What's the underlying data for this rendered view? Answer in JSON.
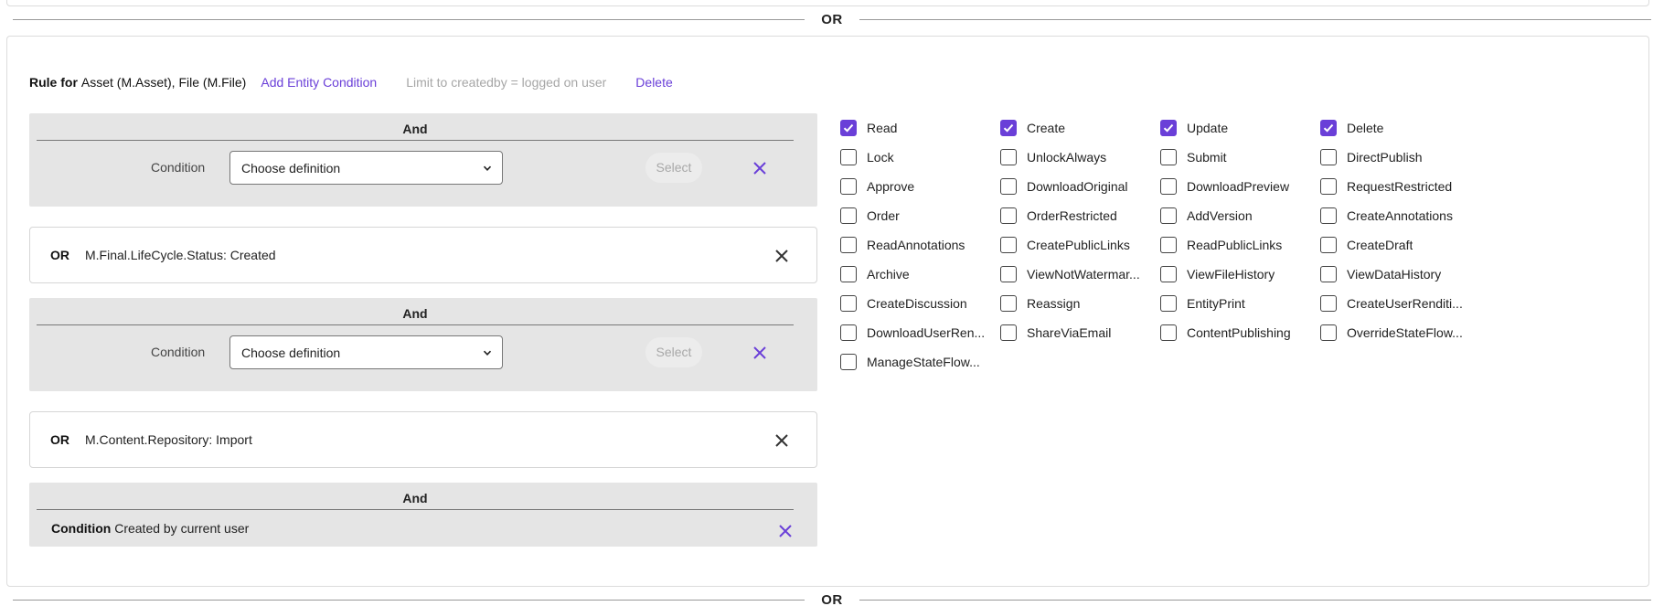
{
  "separator_label": "OR",
  "rule": {
    "lead": "Rule for",
    "entities": "Asset (M.Asset), File (M.File)",
    "add_entity_condition": "Add Entity Condition",
    "limit_createdby": "Limit to createdby = logged on user",
    "delete": "Delete"
  },
  "and_blocks": [
    {
      "title": "And",
      "condition_label": "Condition",
      "select_value": "Choose definition",
      "select_button": "Select"
    },
    {
      "title": "And",
      "condition_label": "Condition",
      "select_value": "Choose definition",
      "select_button": "Select"
    },
    {
      "title": "And",
      "condition_label": "Condition",
      "condition_text": "Created by current user"
    }
  ],
  "or_rows": [
    {
      "label": "OR",
      "value": "M.Final.LifeCycle.Status: Created"
    },
    {
      "label": "OR",
      "value": "M.Content.Repository: Import"
    }
  ],
  "accent_color": "#6a3fd8",
  "permissions": [
    {
      "label": "Read",
      "checked": true
    },
    {
      "label": "Create",
      "checked": true
    },
    {
      "label": "Update",
      "checked": true
    },
    {
      "label": "Delete",
      "checked": true
    },
    {
      "label": "Lock",
      "checked": false
    },
    {
      "label": "UnlockAlways",
      "checked": false
    },
    {
      "label": "Submit",
      "checked": false
    },
    {
      "label": "DirectPublish",
      "checked": false
    },
    {
      "label": "Approve",
      "checked": false
    },
    {
      "label": "DownloadOriginal",
      "checked": false
    },
    {
      "label": "DownloadPreview",
      "checked": false
    },
    {
      "label": "RequestRestricted",
      "checked": false
    },
    {
      "label": "Order",
      "checked": false
    },
    {
      "label": "OrderRestricted",
      "checked": false
    },
    {
      "label": "AddVersion",
      "checked": false
    },
    {
      "label": "CreateAnnotations",
      "checked": false
    },
    {
      "label": "ReadAnnotations",
      "checked": false
    },
    {
      "label": "CreatePublicLinks",
      "checked": false
    },
    {
      "label": "ReadPublicLinks",
      "checked": false
    },
    {
      "label": "CreateDraft",
      "checked": false
    },
    {
      "label": "Archive",
      "checked": false
    },
    {
      "label": "ViewNotWatermar...",
      "checked": false
    },
    {
      "label": "ViewFileHistory",
      "checked": false
    },
    {
      "label": "ViewDataHistory",
      "checked": false
    },
    {
      "label": "CreateDiscussion",
      "checked": false
    },
    {
      "label": "Reassign",
      "checked": false
    },
    {
      "label": "EntityPrint",
      "checked": false
    },
    {
      "label": "CreateUserRenditi...",
      "checked": false
    },
    {
      "label": "DownloadUserRen...",
      "checked": false
    },
    {
      "label": "ShareViaEmail",
      "checked": false
    },
    {
      "label": "ContentPublishing",
      "checked": false
    },
    {
      "label": "OverrideStateFlow...",
      "checked": false
    },
    {
      "label": "ManageStateFlow...",
      "checked": false
    }
  ]
}
